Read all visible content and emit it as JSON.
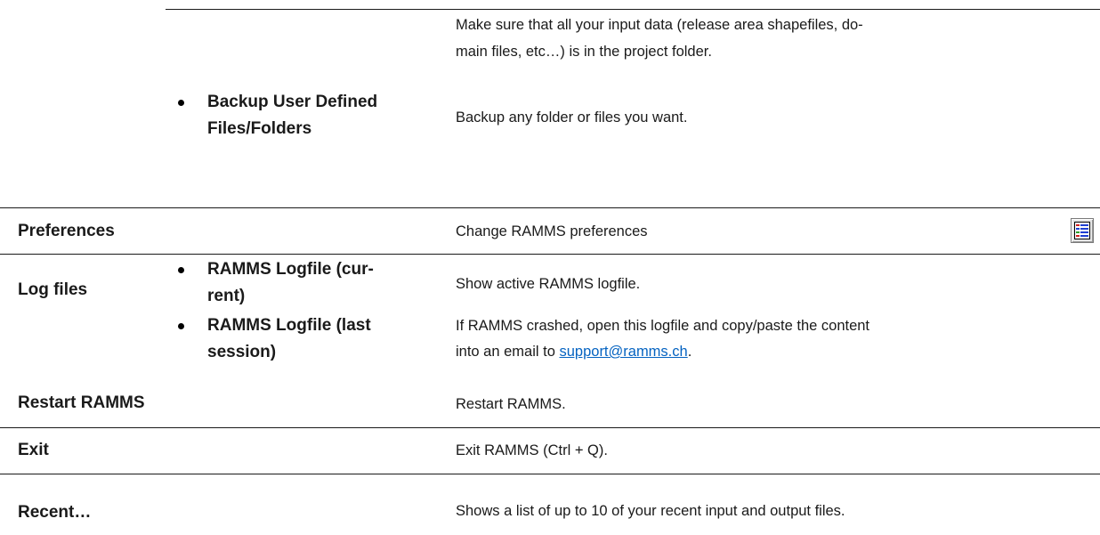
{
  "rows": {
    "project_folder_desc_line1": "Make sure that all your input data (release area shapefiles, do-",
    "project_folder_desc_line2": "main files, etc…) is in the project folder.",
    "backup": {
      "label_line1": "Backup User Defined",
      "label_line2": "Files/Folders",
      "description": "Backup any folder or files you want."
    },
    "preferences": {
      "label": "Preferences",
      "description": "Change RAMMS preferences",
      "icon": "preferences-icon"
    },
    "log_files": {
      "label": "Log files",
      "current_line1": "RAMMS Logfile (cur-",
      "current_line2": "rent)",
      "current_description": "Show active RAMMS logfile.",
      "last_line1": "RAMMS Logfile (last",
      "last_line2": "session)",
      "last_description_line1": "If RAMMS crashed, open this logfile and copy/paste the content",
      "last_description_prefix": "into an email to ",
      "support_email": "support@ramms.ch",
      "last_description_suffix": "."
    },
    "restart": {
      "label": "Restart RAMMS",
      "description": "Restart RAMMS."
    },
    "exit": {
      "label": "Exit",
      "description": "Exit RAMMS (Ctrl + Q)."
    },
    "recent": {
      "label": "Recent…",
      "description": "Shows a list of up to 10 of your recent input and output files."
    }
  },
  "colors": {
    "text": "#1a1a1a",
    "link": "#0563c1",
    "rule": "#1a1a1a"
  }
}
